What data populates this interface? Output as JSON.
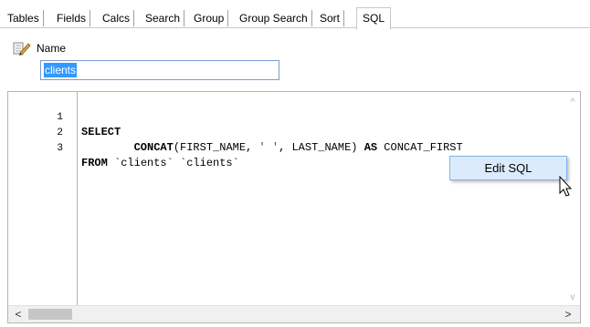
{
  "tabs": [
    "Tables",
    "Fields",
    "Calcs",
    "Search",
    "Group",
    "Group Search",
    "Sort",
    "SQL"
  ],
  "active_tab": "SQL",
  "name_section": {
    "label": "Name",
    "icon": "pencil-icon",
    "value": "clients"
  },
  "editor": {
    "lines": [
      {
        "num": "1",
        "text": "SELECT"
      },
      {
        "num": "2",
        "text": "        CONCAT(FIRST_NAME, ' ', LAST_NAME) AS CONCAT_FIRST"
      },
      {
        "num": "3",
        "text": "FROM `clients` `clients`"
      }
    ]
  },
  "context_menu": {
    "item": "Edit SQL"
  },
  "scrollbar": {
    "left_arrow": "<",
    "right_arrow": ">",
    "up_arrow": "^",
    "down_arrow": "v"
  }
}
